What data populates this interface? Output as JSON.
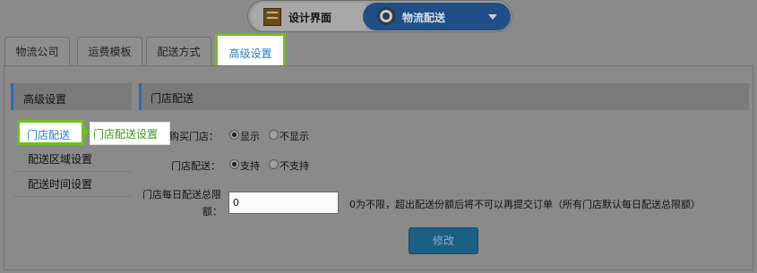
{
  "switcher": {
    "left_label": "设计界面",
    "right_label": "物流配送"
  },
  "tabs": [
    {
      "label": "物流公司"
    },
    {
      "label": "运费模板"
    },
    {
      "label": "配送方式"
    },
    {
      "label": "高级设置"
    }
  ],
  "sidebar": {
    "title": "高级设置",
    "items": [
      {
        "label": "门店配送"
      },
      {
        "label": "配送区域设置"
      },
      {
        "label": "配送时间设置"
      }
    ]
  },
  "callout": "门店配送设置",
  "section": {
    "title": "门店配送"
  },
  "form": {
    "purchase_store": {
      "label": "购买门店：",
      "options": [
        {
          "label": "显示",
          "checked": true
        },
        {
          "label": "不显示",
          "checked": false
        }
      ]
    },
    "store_delivery": {
      "label": "门店配送：",
      "options": [
        {
          "label": "支持",
          "checked": true
        },
        {
          "label": "不支持",
          "checked": false
        }
      ]
    },
    "daily_limit": {
      "label_line1": "门店每日配送总限",
      "label_line2": "额：",
      "value": "0",
      "hint": "0为不限，超出配送份额后将不可以再提交订单（所有门店默认每日配送总限额）"
    },
    "submit_label": "修改"
  }
}
